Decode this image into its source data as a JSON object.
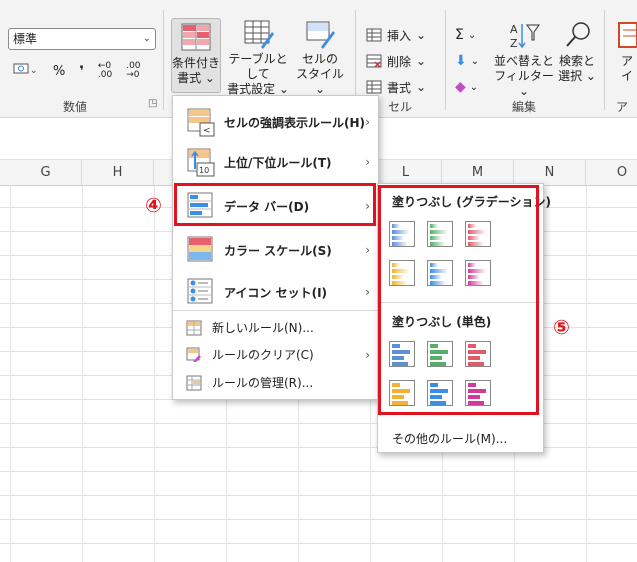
{
  "ribbon": {
    "number_group": {
      "format_value": "標準",
      "buttons": [
        "currency-format",
        "%",
        "comma-style",
        "increase-decimal",
        "decrease-decimal"
      ],
      "label": "数値"
    },
    "styles_group": {
      "conditional_formatting": {
        "line1": "条件付き",
        "line2": "書式 ⌄"
      },
      "format_as_table": {
        "line1": "テーブルとして",
        "line2": "書式設定 ⌄"
      },
      "cell_styles": {
        "line1": "セルの",
        "line2": "スタイル ⌄"
      }
    },
    "cells_group": {
      "insert": "挿入",
      "delete": "削除",
      "format": "書式",
      "label": "セル"
    },
    "editing_group": {
      "sort_filter": {
        "line1": "並べ替えと",
        "line2": "フィルター ⌄"
      },
      "find_select": {
        "line1": "検索と",
        "line2": "選択 ⌄"
      },
      "label": "編集"
    },
    "cutoff_right": {
      "line1": "ア",
      "line2": "イ",
      "label": "アド"
    }
  },
  "columns": [
    "G",
    "H",
    "L",
    "M",
    "N",
    "O"
  ],
  "cf_menu": {
    "items": [
      {
        "label": "セルの強調表示ルール(H)",
        "has_submenu": true
      },
      {
        "label": "上位/下位ルール(T)",
        "has_submenu": true
      },
      {
        "label": "データ バー(D)",
        "has_submenu": true
      },
      {
        "label": "カラー スケール(S)",
        "has_submenu": true
      },
      {
        "label": "アイコン セット(I)",
        "has_submenu": true
      }
    ],
    "small_items": [
      {
        "label": "新しいルール(N)...",
        "has_submenu": false
      },
      {
        "label": "ルールのクリア(C)",
        "has_submenu": true
      },
      {
        "label": "ルールの管理(R)...",
        "has_submenu": false
      }
    ]
  },
  "databar_submenu": {
    "gradient_heading": "塗りつぶし (グラデーション)",
    "solid_heading": "塗りつぶし (単色)",
    "colors": [
      "#5b8fd6",
      "#52b06a",
      "#e05a6a",
      "#f2b233",
      "#3a8ee6",
      "#d13a9a"
    ],
    "other_rules": "その他のルール(M)..."
  },
  "callouts": {
    "step4": "④",
    "step5": "⑤"
  }
}
